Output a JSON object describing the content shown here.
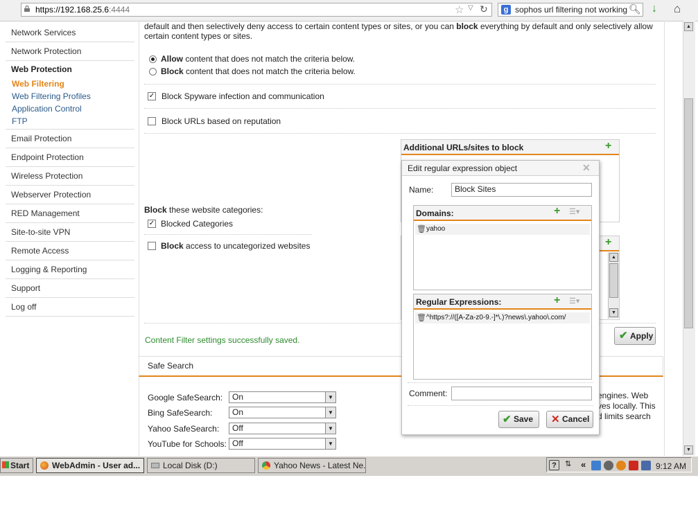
{
  "browser": {
    "url_host": "https://192.168.25.6",
    "url_port": ":4444",
    "search_engine": "g-logo",
    "search_text": "sophos url filtering not working"
  },
  "sidebar": {
    "items": [
      {
        "label": "Network Services"
      },
      {
        "label": "Network Protection"
      },
      {
        "label": "Web Protection"
      },
      {
        "label": "Email Protection"
      },
      {
        "label": "Endpoint Protection"
      },
      {
        "label": "Wireless Protection"
      },
      {
        "label": "Webserver Protection"
      },
      {
        "label": "RED Management"
      },
      {
        "label": "Site-to-site VPN"
      },
      {
        "label": "Remote Access"
      },
      {
        "label": "Logging & Reporting"
      },
      {
        "label": "Support"
      },
      {
        "label": "Log off"
      }
    ],
    "web_protection_sub": [
      {
        "label": "Web Filtering",
        "active": true
      },
      {
        "label": "Web Filtering Profiles"
      },
      {
        "label": "Application Control"
      },
      {
        "label": "FTP"
      }
    ]
  },
  "main": {
    "intro_l1_pre": "default and then selectively deny access to certain content types or sites, or you can ",
    "intro_l1_bold": "block",
    "intro_l1_post": " everything by default and only selectively allow",
    "intro_l2": "certain content types or sites.",
    "allow_bold": "Allow",
    "allow_text": " content that does not match the criteria below.",
    "block_bold": "Block",
    "block_text": " content that does not match the criteria below.",
    "spyware_label": "Block Spyware infection and communication",
    "reputation_label": "Block URLs based on reputation",
    "additional_panel_title": "Additional URLs/sites to block",
    "categories_bold": "Block",
    "categories_text": " these website categories:",
    "blocked_categories_label": "Blocked Categories",
    "uncat_pre": "",
    "uncat_bold": "Block",
    "uncat_post": " access to uncategorized websites",
    "success_message": "Content Filter settings successfully saved.",
    "apply_label": "Apply"
  },
  "safe_search": {
    "title": "Safe Search",
    "rows": [
      {
        "label": "Google SafeSearch:",
        "value": "On"
      },
      {
        "label": "Bing SafeSearch:",
        "value": "On"
      },
      {
        "label": "Yahoo SafeSearch:",
        "value": "Off"
      },
      {
        "label": "YouTube for Schools:",
        "value": "Off"
      }
    ],
    "right_text_l1": "engines. Web",
    "right_text_l2": "ves locally. This",
    "right_text_l3": "d limits search"
  },
  "dialog": {
    "title": "Edit regular expression object",
    "name_label": "Name:",
    "name_value": "Block Sites",
    "domains_title": "Domains:",
    "domains": [
      "yahoo"
    ],
    "regex_title": "Regular Expressions:",
    "regex": [
      "^https?://([A-Za-z0-9.-]*\\.)?news\\.yahoo\\.com/"
    ],
    "comment_label": "Comment:",
    "comment_value": "",
    "save_label": "Save",
    "cancel_label": "Cancel"
  },
  "taskbar": {
    "start_label": "Start",
    "tasks": [
      {
        "label": "WebAdmin - User ad..."
      },
      {
        "label": "Local Disk (D:)"
      },
      {
        "label": "Yahoo News - Latest Ne..."
      }
    ],
    "clock": "9:12 AM"
  },
  "colors": {
    "accent": "#e2851a",
    "success": "#2e8b2e",
    "add": "#3c9a2e",
    "link": "#2b5a8a"
  }
}
